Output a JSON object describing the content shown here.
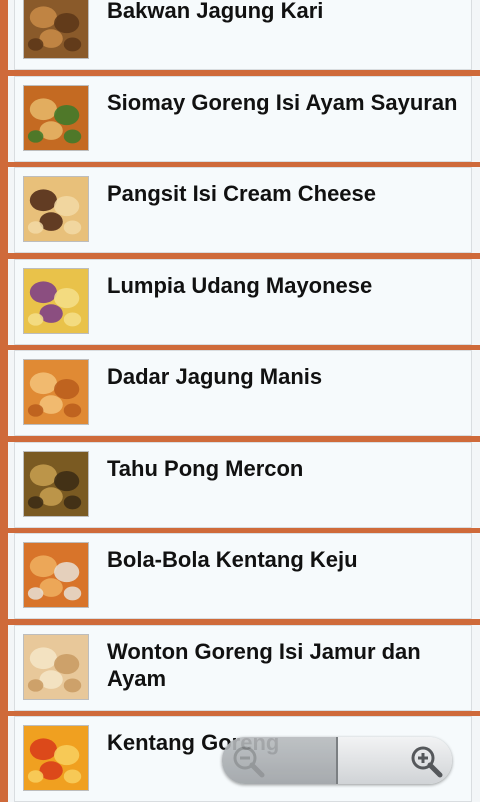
{
  "items": [
    {
      "title": "Bakwan Jagung Kari",
      "icon": "fritter-thumbnail",
      "colors": [
        "#8a5a2a",
        "#c98c48",
        "#5a3618"
      ]
    },
    {
      "title": "Siomay Goreng Isi Ayam Sayuran",
      "icon": "dumpling-thumbnail",
      "colors": [
        "#c46a22",
        "#e8b86a",
        "#3b7a2a"
      ]
    },
    {
      "title": "Pangsit Isi Cream Cheese",
      "icon": "wonton-thumbnail",
      "colors": [
        "#e8c07a",
        "#4a2414",
        "#f2d9a6"
      ]
    },
    {
      "title": "Lumpia Udang Mayonese",
      "icon": "spring-roll-thumbnail",
      "colors": [
        "#e9c24a",
        "#7a3a8a",
        "#f5df8a"
      ]
    },
    {
      "title": "Dadar Jagung Manis",
      "icon": "corn-fritter-thumbnail",
      "colors": [
        "#e08a34",
        "#f3c27a",
        "#b85c1c"
      ]
    },
    {
      "title": "Tahu Pong Mercon",
      "icon": "tofu-thumbnail",
      "colors": [
        "#7a5a22",
        "#c8a050",
        "#3a2a14"
      ]
    },
    {
      "title": "Bola-Bola Kentang Keju",
      "icon": "potato-ball-thumbnail",
      "colors": [
        "#d8742a",
        "#f0b060",
        "#e8e0d6"
      ]
    },
    {
      "title": "Wonton Goreng Isi Jamur dan Ayam",
      "icon": "fried-wonton-thumbnail",
      "colors": [
        "#e8c89a",
        "#f5e6c8",
        "#c89a62"
      ]
    },
    {
      "title": "Kentang Goreng",
      "icon": "fries-thumbnail",
      "colors": [
        "#f0a020",
        "#d83a1a",
        "#f8d060"
      ]
    }
  ],
  "zoom": {
    "zoom_out_icon": "zoom-out-icon",
    "zoom_in_icon": "zoom-in-icon"
  }
}
